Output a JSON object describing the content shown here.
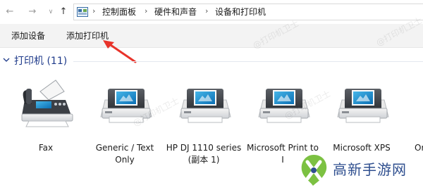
{
  "breadcrumb": {
    "items": [
      "控制面板",
      "硬件和声音",
      "设备和打印机"
    ]
  },
  "commandbar": {
    "add_device": "添加设备",
    "add_printer": "添加打印机"
  },
  "group": {
    "title": "打印机 (11)"
  },
  "devices": [
    {
      "label": "Fax",
      "icon": "fax-icon"
    },
    {
      "label": "Generic / Text Only",
      "icon": "printer-icon"
    },
    {
      "label": "HP DJ 1110 series (副本 1)",
      "icon": "printer-icon"
    },
    {
      "label": "Microsoft Print to I",
      "icon": "printer-icon"
    },
    {
      "label": "Microsoft XPS",
      "icon": "printer-icon"
    },
    {
      "label": "Or",
      "icon": "printer-icon"
    }
  ],
  "watermark": "@打印机卫士",
  "badge": {
    "text": "高新手游网"
  },
  "colors": {
    "group_title": "#1e3a8a",
    "annotation_arrow": "#e8332a",
    "badge_green": "#7cc142",
    "badge_blue": "#2f4f8f"
  }
}
